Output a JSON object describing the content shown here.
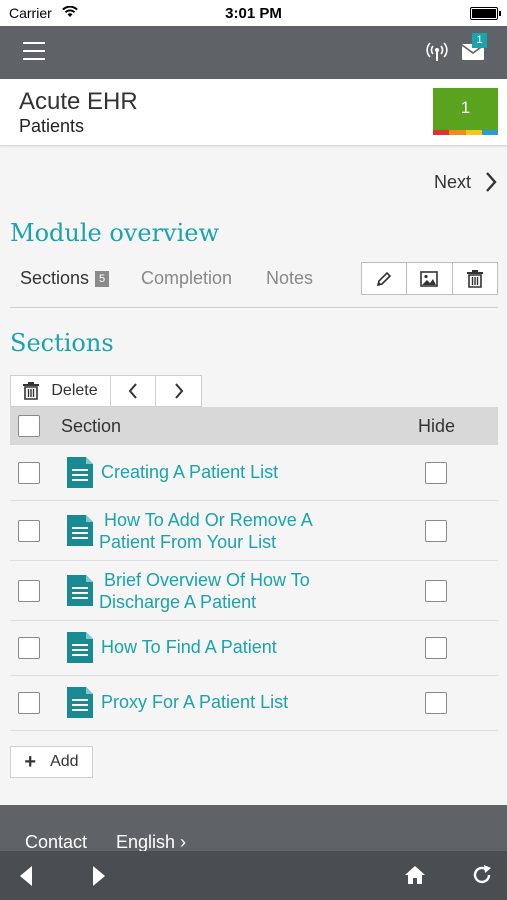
{
  "status_bar": {
    "carrier": "Carrier",
    "time": "3:01 PM"
  },
  "topbar": {
    "menu_icon": "hamburger-icon",
    "signal_icon": "broadcast-icon",
    "mail_icon": "mail-icon",
    "mail_badge": "1"
  },
  "header": {
    "app_title": "Acute EHR",
    "subtitle": "Patients",
    "progress_value": "1"
  },
  "nav": {
    "next_label": "Next"
  },
  "module": {
    "title": "Module overview",
    "tabs": [
      {
        "label": "Sections",
        "count": "5",
        "active": true
      },
      {
        "label": "Completion"
      },
      {
        "label": "Notes"
      }
    ],
    "tools": [
      "edit-icon",
      "image-icon",
      "trash-icon"
    ]
  },
  "sections": {
    "title": "Sections",
    "toolbar": {
      "delete_label": "Delete"
    },
    "columns": {
      "section": "Section",
      "hide": "Hide"
    },
    "rows": [
      {
        "line1": "Creating A Patient List",
        "line2": ""
      },
      {
        "line1": "How To Add Or Remove A",
        "line2": "Patient From Your List"
      },
      {
        "line1": "Brief Overview Of How To",
        "line2": "Discharge A Patient"
      },
      {
        "line1": "How To Find A Patient",
        "line2": ""
      },
      {
        "line1": "Proxy For A Patient List",
        "line2": ""
      }
    ],
    "add_label": "Add"
  },
  "footer": {
    "contact": "Contact",
    "language": "English ›"
  },
  "colors": {
    "accent": "#1aa3ac",
    "bar": "#5f6266",
    "progress": "#5aa31e"
  }
}
